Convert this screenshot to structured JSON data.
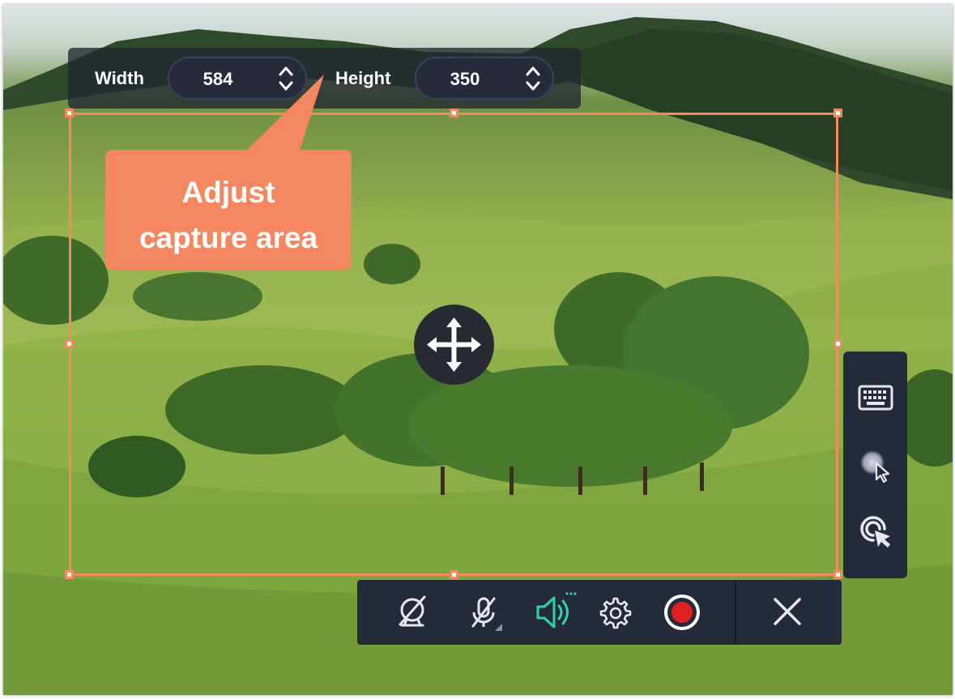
{
  "capture": {
    "width_label": "Width",
    "width_value": "584",
    "height_label": "Height",
    "height_value": "350"
  },
  "callout": {
    "line1": "Adjust",
    "line2": "capture area"
  },
  "side_toolbar": [
    "keyboard-icon",
    "cursor-highlight-icon",
    "click-effect-icon"
  ],
  "bottom_toolbar": [
    "webcam-off-icon",
    "microphone-off-icon",
    "system-audio-icon",
    "settings-icon",
    "record-icon",
    "close-icon"
  ],
  "colors": {
    "accent": "#f48b5e",
    "toolbar_bg": "#252a3a",
    "audio_active": "#2ed3b0",
    "record": "#e02020"
  }
}
